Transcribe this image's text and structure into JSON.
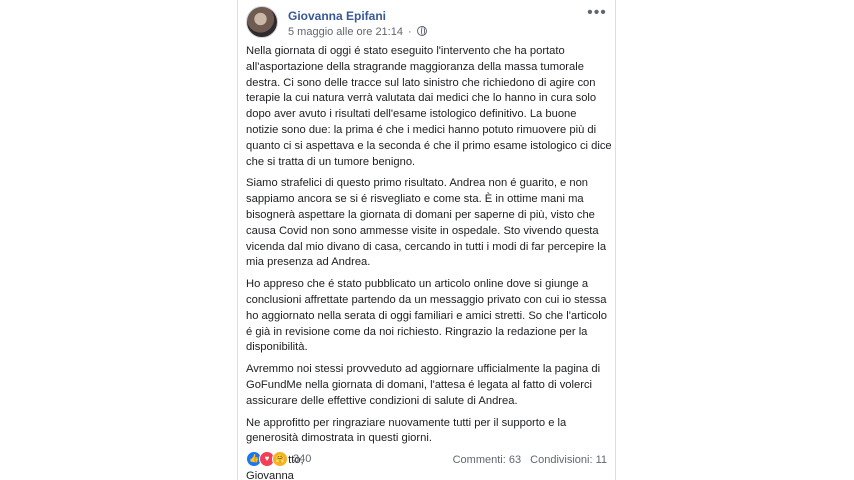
{
  "post": {
    "author": "Giovanna Epifani",
    "timestamp": "5 maggio alle ore 21:14",
    "separator": "·",
    "privacy_icon": "globe-icon",
    "more_icon": "ellipsis-icon",
    "paragraphs": [
      "Nella giornata di oggi é stato eseguito l'intervento che ha portato\nall'asportazione della stragrande maggioranza della massa tumorale\ndestra. Ci sono delle tracce sul lato sinistro che richiedono di agire con\nterapie la cui natura verrà valutata dai medici che lo hanno in cura solo\ndopo aver avuto i risultati dell'esame istologico definitivo. La buone\nnotizie sono due: la prima é che i medici hanno potuto rimuovere più di\nquanto ci si aspettava e la seconda é che il primo esame istologico ci dice\nche si tratta di un tumore benigno.",
      "Siamo strafelici di questo primo risultato. Andrea non é guarito, e non\nsappiamo ancora se si é risvegliato e come sta. È in ottime mani ma\nbisognerà aspettare la giornata di domani per saperne di più, visto che\ncausa Covid non sono ammesse visite in ospedale. Sto vivendo questa\nvicenda dal mio divano di casa, cercando in tutti i modi di far percepire la\nmia presenza ad Andrea.",
      "Ho appreso che é stato pubblicato un articolo online dove si giunge a\nconclusioni affrettate partendo da un messaggio privato con cui io stessa\nho aggiornato nella serata di oggi familiari e amici stretti. So che l'articolo\né già in revisione come da noi richiesto. Ringrazio la redazione per la\ndisponibilità.",
      "Avremmo noi stessi provveduto ad aggiornare ufficialmente la pagina di\nGoFundMe nella giornata di domani, l'attesa é legata al fatto di volerci\nassicurare delle effettive condizioni di salute di Andrea.",
      "Ne approfitto per ringraziare nuovamente tutti per il supporto e la\ngenerosità dimostrata in questi giorni.",
      "Con affetto,\nGiovanna"
    ],
    "reactions": {
      "icons": [
        "like-icon",
        "love-icon",
        "care-icon"
      ],
      "glyphs": [
        "👍",
        "♥",
        "🤗"
      ],
      "colors": [
        "#1877f2",
        "#f33e58",
        "#f7b125"
      ],
      "count": "340"
    },
    "comments": "Commenti: 63",
    "shares": "Condivisioni: 11"
  }
}
